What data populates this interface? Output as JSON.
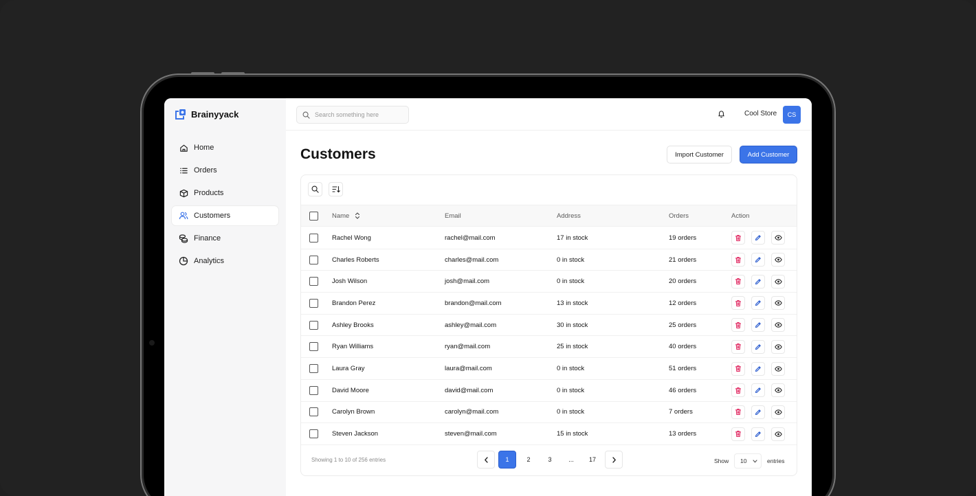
{
  "brand": {
    "name": "Brainyyack"
  },
  "sidebar": {
    "items": [
      {
        "label": "Home",
        "icon": "home-icon",
        "active": false
      },
      {
        "label": "Orders",
        "icon": "list-icon",
        "active": false
      },
      {
        "label": "Products",
        "icon": "box-icon",
        "active": false
      },
      {
        "label": "Customers",
        "icon": "users-icon",
        "active": true
      },
      {
        "label": "Finance",
        "icon": "coins-icon",
        "active": false
      },
      {
        "label": "Analytics",
        "icon": "pie-chart-icon",
        "active": false
      }
    ]
  },
  "topbar": {
    "search_placeholder": "Search something here",
    "store_name": "Cool Store",
    "avatar_initials": "CS"
  },
  "page": {
    "title": "Customers",
    "import_label": "Import Customer",
    "add_label": "Add Customer"
  },
  "table": {
    "headers": {
      "name": "Name",
      "email": "Email",
      "address": "Address",
      "orders": "Orders",
      "action": "Action"
    },
    "rows": [
      {
        "name": "Rachel Wong",
        "email": "rachel@mail.com",
        "address": "17 in stock",
        "orders": "19 orders"
      },
      {
        "name": "Charles Roberts",
        "email": "charles@mail.com",
        "address": "0 in stock",
        "orders": "21 orders"
      },
      {
        "name": "Josh Wilson",
        "email": "josh@mail.com",
        "address": "0 in stock",
        "orders": "20 orders"
      },
      {
        "name": "Brandon Perez",
        "email": "brandon@mail.com",
        "address": "13 in stock",
        "orders": "12 orders"
      },
      {
        "name": "Ashley Brooks",
        "email": "ashley@mail.com",
        "address": "30 in stock",
        "orders": "25 orders"
      },
      {
        "name": "Ryan Williams",
        "email": "ryan@mail.com",
        "address": "25 in stock",
        "orders": "40 orders"
      },
      {
        "name": "Laura Gray",
        "email": "laura@mail.com",
        "address": "0 in stock",
        "orders": "51 orders"
      },
      {
        "name": "David Moore",
        "email": "david@mail.com",
        "address": "0 in stock",
        "orders": "46 orders"
      },
      {
        "name": "Carolyn Brown",
        "email": "carolyn@mail.com",
        "address": "0 in stock",
        "orders": "7 orders"
      },
      {
        "name": "Steven Jackson",
        "email": "steven@mail.com",
        "address": "15 in stock",
        "orders": "13 orders"
      }
    ]
  },
  "footer": {
    "info": "Showing 1 to 10 of 256 entries",
    "pages": [
      "1",
      "2",
      "3",
      "...",
      "17"
    ],
    "active_page": "1",
    "show_label": "Show",
    "page_size": "10",
    "entries_label": "entries"
  },
  "colors": {
    "accent": "#3b74e8",
    "delete": "#e0245e",
    "edit": "#2f5fd0",
    "view": "#222222"
  }
}
